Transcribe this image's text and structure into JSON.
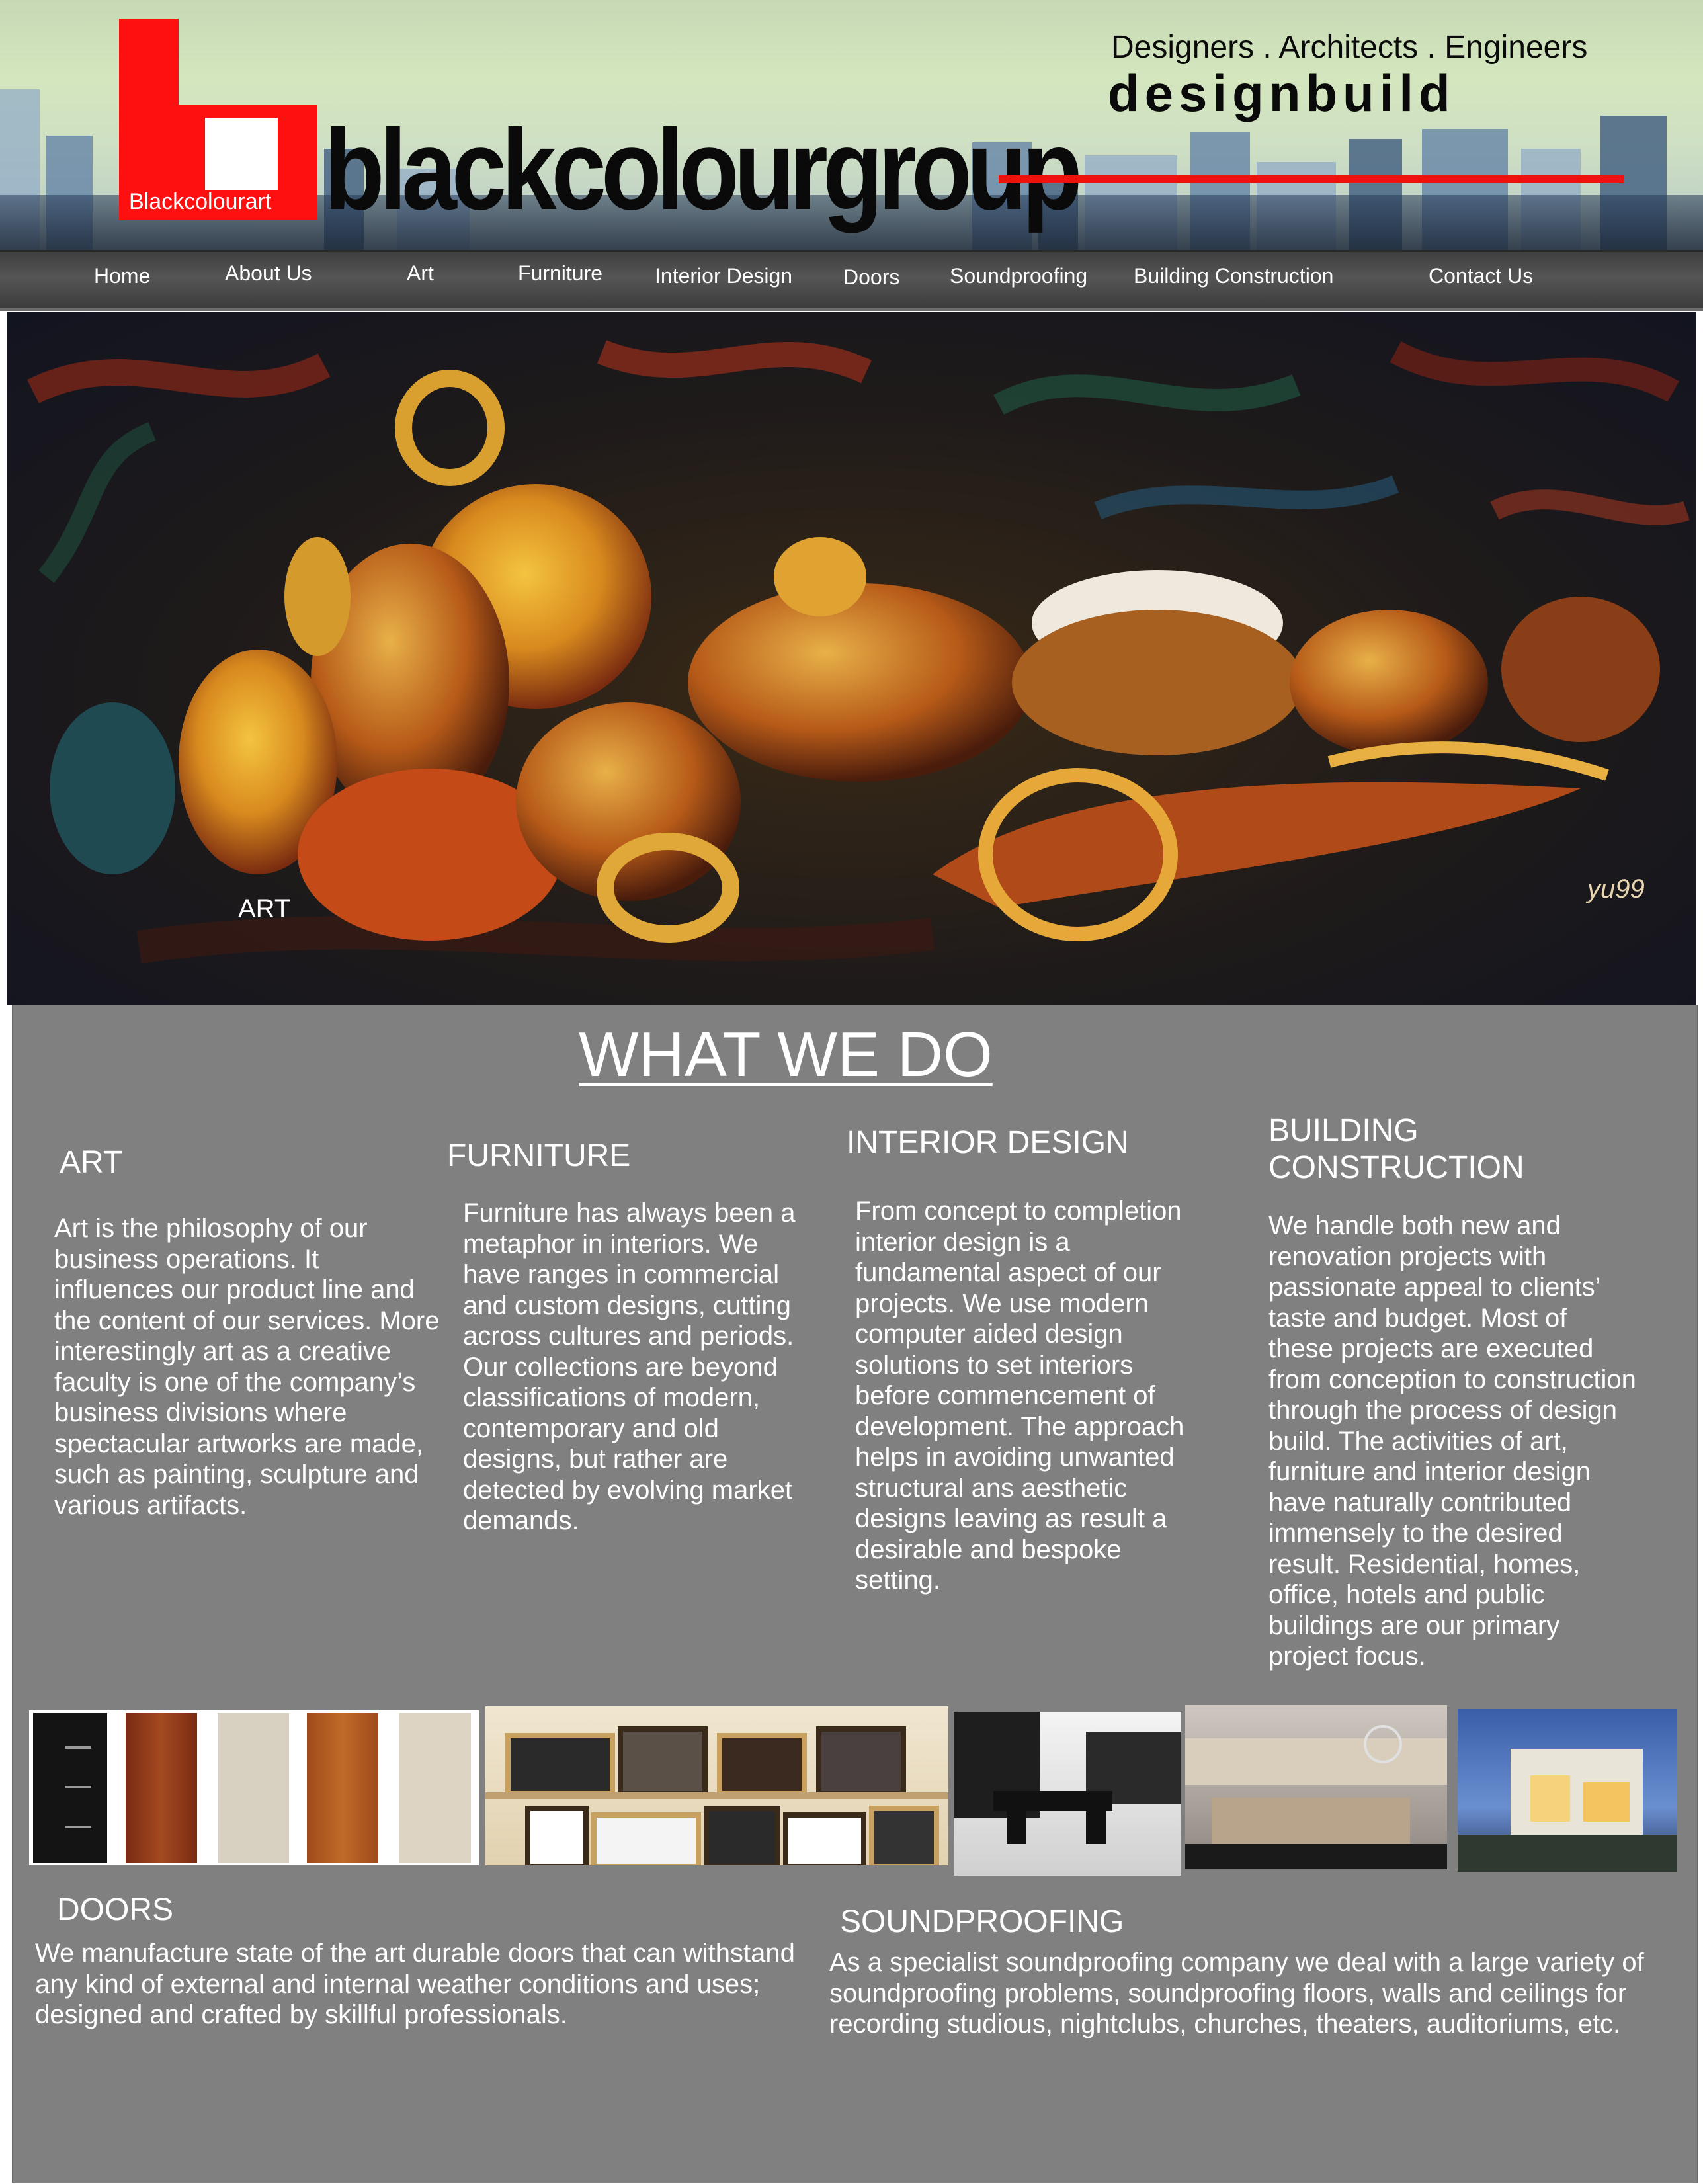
{
  "header": {
    "logo_caption": "Blackcolourart",
    "brand_name": "blackcolourgroup",
    "tagline": "Designers . Architects . Engineers",
    "subbrand": "designbuild",
    "logo_icon": "blackcolourart-logo-icon"
  },
  "nav": {
    "items": [
      {
        "label": "Home"
      },
      {
        "label": "About Us"
      },
      {
        "label": "Art"
      },
      {
        "label": "Furniture"
      },
      {
        "label": "Interior Design"
      },
      {
        "label": "Doors"
      },
      {
        "label": "Soundproofing"
      },
      {
        "label": "Building Construction"
      },
      {
        "label": "Contact Us"
      }
    ]
  },
  "hero": {
    "caption": "ART",
    "signature": "yu99"
  },
  "section": {
    "title": "WHAT WE DO"
  },
  "services": [
    {
      "heading": "ART",
      "body": "Art is the philosophy of our business operations. It influences our product line and the content of our services. More interestingly art as a creative faculty is one of the company’s business divisions where spectacular artworks are made, such as painting, sculpture and various artifacts."
    },
    {
      "heading": "FURNITURE",
      "body": "Furniture has always been a metaphor in interiors. We have ranges in commercial and custom designs, cutting across cultures and periods. Our collections are beyond classifications of modern, contemporary and old designs, but rather are detected by evolving market demands."
    },
    {
      "heading": "INTERIOR DESIGN",
      "body": "From concept to completion interior design is a fundamental aspect of our projects. We use modern computer aided design solutions to set interiors before commencement of development. The approach helps in avoiding unwanted structural ans aesthetic designs leaving as result a desirable and bespoke setting."
    },
    {
      "heading": "BUILDING CONSTRUCTION",
      "body": "We handle both new and renovation projects with passionate appeal to clients’ taste and budget. Most of these projects are executed from conception to construction through the process of design build. The activities of art, furniture and interior design have naturally contributed immensely to the desired result. Residential, homes, office, hotels and public buildings are our primary project focus."
    }
  ],
  "bottom": {
    "doors": {
      "heading": "DOORS",
      "body": "We manufacture state of the art durable doors that can withstand any kind of external and internal weather conditions and uses; designed and crafted by skillful professionals."
    },
    "soundproofing": {
      "heading": "SOUNDPROOFING",
      "body": "As a specialist soundproofing  company we deal with a large variety of soundproofing problems, soundproofing floors, walls and ceilings for recording studious, nightclubs, churches, theaters, auditoriums, etc."
    }
  },
  "colors": {
    "accent_red": "#ee1111",
    "nav_bg": "#4a4a4a",
    "content_bg": "#808080"
  }
}
